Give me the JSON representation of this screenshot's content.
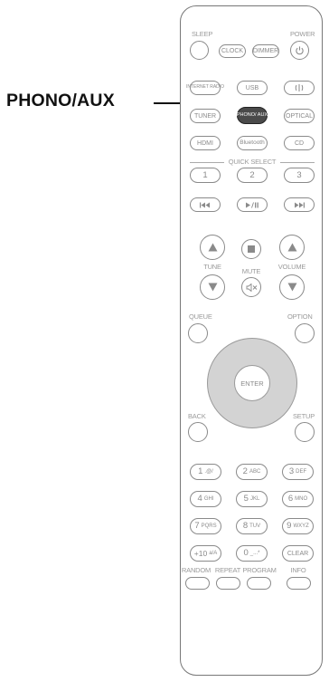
{
  "callout": {
    "label": "PHONO/AUX"
  },
  "labels": {
    "sleep": "SLEEP",
    "power": "POWER",
    "quick_select": "QUICK SELECT",
    "tune": "TUNE",
    "mute": "MUTE",
    "volume": "VOLUME",
    "queue": "QUEUE",
    "option": "OPTION",
    "back": "BACK",
    "setup": "SETUP",
    "random": "RANDOM",
    "repeat": "REPEAT",
    "program": "PROGRAM",
    "info": "INFO"
  },
  "buttons": {
    "clock": "CLOCK",
    "dimmer": "DIMMER",
    "internet_radio": "INTERNET RADIO",
    "usb": "USB",
    "tuner": "TUNER",
    "phono_aux": "PHONO/ AUX",
    "optical": "OPTICAL",
    "hdmi": "HDMI",
    "bluetooth": "Bluetooth",
    "cd": "CD",
    "qs1": "1",
    "qs2": "2",
    "qs3": "3",
    "enter": "ENTER",
    "key_1": "1",
    "key_1_sub": ".@/",
    "key_2": "2",
    "key_2_sub": "ABC",
    "key_3": "3",
    "key_3_sub": "DEF",
    "key_4": "4",
    "key_4_sub": "GHI",
    "key_5": "5",
    "key_5_sub": "JKL",
    "key_6": "6",
    "key_6_sub": "MNO",
    "key_7": "7",
    "key_7_sub": "PQRS",
    "key_8": "8",
    "key_8_sub": "TUV",
    "key_9": "9",
    "key_9_sub": "WXYZ",
    "key_10": "+10",
    "key_10_sub": "a/A",
    "key_0": "0",
    "key_0_sub": "_...*",
    "clear": "CLEAR"
  },
  "icons": {
    "power": "power-icon",
    "antenna": "antenna-icon",
    "prev": "skip-back-icon",
    "playpause": "play-pause-icon",
    "next": "skip-forward-icon",
    "stop": "stop-icon",
    "mute": "speaker-mute-icon"
  }
}
